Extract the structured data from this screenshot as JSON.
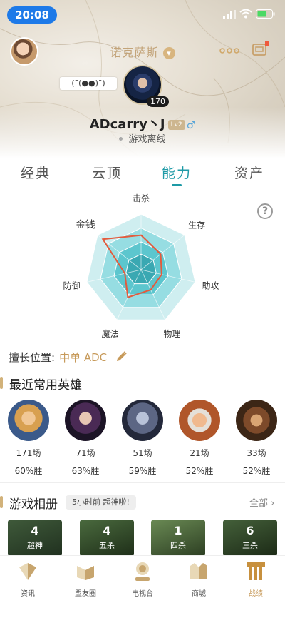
{
  "status_bar": {
    "time": "20:08"
  },
  "header": {
    "server_name": "诺克萨斯",
    "kaomoji": "(¯(●●)¯)",
    "hero_level": "170",
    "player_name": "ADcarry丶J",
    "player_lv": "Lv2",
    "gender_symbol": "♂",
    "status": "游戏离线"
  },
  "tabs": [
    {
      "label": "经典"
    },
    {
      "label": "云顶"
    },
    {
      "label": "能力",
      "active": true
    },
    {
      "label": "资产"
    }
  ],
  "ability": {
    "labels": [
      "击杀",
      "生存",
      "助攻",
      "物理",
      "魔法",
      "防御",
      "金钱"
    ],
    "help": "?"
  },
  "chart_data": {
    "type": "radar",
    "axes": [
      "击杀",
      "生存",
      "助攻",
      "物理",
      "魔法",
      "防御",
      "金钱"
    ],
    "values": [
      0.62,
      0.45,
      0.38,
      0.4,
      0.55,
      0.3,
      0.88
    ],
    "range": [
      0,
      1
    ],
    "colors": {
      "outline": "#e35b3d",
      "rings": [
        "#cfeef0",
        "#96dde2",
        "#5cc6ce",
        "#3aa8b2"
      ]
    }
  },
  "position": {
    "label": "擅长位置:",
    "value": "中单 ADC"
  },
  "recent_heroes": {
    "title": "最近常用英雄",
    "items": [
      {
        "games": "171场",
        "win": "60%胜"
      },
      {
        "games": "71场",
        "win": "63%胜"
      },
      {
        "games": "51场",
        "win": "59%胜"
      },
      {
        "games": "21场",
        "win": "52%胜"
      },
      {
        "games": "33场",
        "win": "52%胜"
      }
    ]
  },
  "album": {
    "title": "游戏相册",
    "badge": "5小时前 超神啦!",
    "all": "全部",
    "cards": [
      {
        "count": "4",
        "label": "超神"
      },
      {
        "count": "4",
        "label": "五杀"
      },
      {
        "count": "1",
        "label": "四杀"
      },
      {
        "count": "6",
        "label": "三杀"
      }
    ]
  },
  "bottom_nav": [
    {
      "label": "资讯"
    },
    {
      "label": "盟友圈"
    },
    {
      "label": "电视台"
    },
    {
      "label": "商城"
    },
    {
      "label": "战绩",
      "active": true
    }
  ]
}
